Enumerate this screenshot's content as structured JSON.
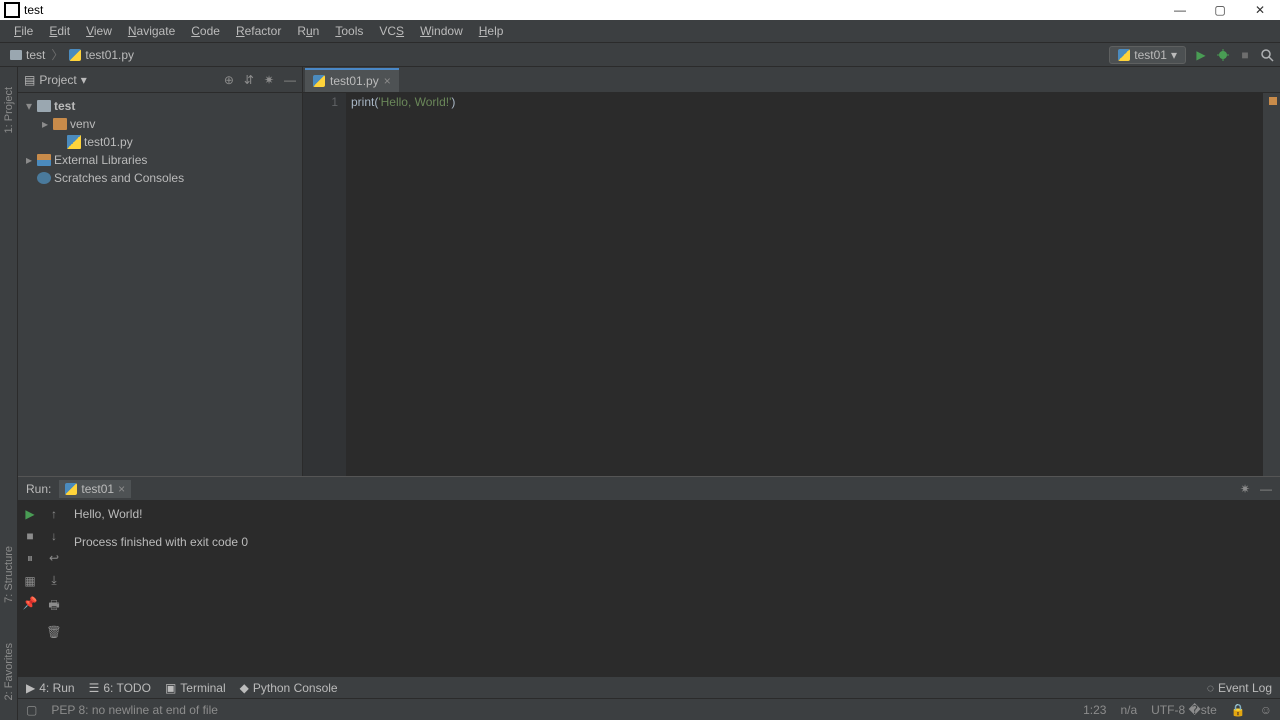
{
  "window": {
    "title": "test"
  },
  "menus": [
    "File",
    "Edit",
    "View",
    "Navigate",
    "Code",
    "Refactor",
    "Run",
    "Tools",
    "VCS",
    "Window",
    "Help"
  ],
  "breadcrumbs": {
    "project": "test",
    "file": "test01.py"
  },
  "run_config": {
    "selected": "test01"
  },
  "project_panel": {
    "title": "Project",
    "tree": {
      "root": "test",
      "venv": "venv",
      "file1": "test01.py",
      "external": "External Libraries",
      "scratches": "Scratches and Consoles"
    }
  },
  "editor": {
    "tab_label": "test01.py",
    "line_numbers": [
      "1"
    ],
    "code": {
      "fn": "print",
      "paren_open": "(",
      "string": "'Hello, World!'",
      "paren_close": ")"
    }
  },
  "run_tool": {
    "label": "Run:",
    "tab": "test01",
    "output_line1": "Hello, World!",
    "output_line2": "",
    "output_line3": "Process finished with exit code 0"
  },
  "bottom_tabs": {
    "run": "4: Run",
    "todo": "6: TODO",
    "terminal": "Terminal",
    "pyconsole": "Python Console",
    "eventlog": "Event Log"
  },
  "status": {
    "msg": "PEP 8: no newline at end of file",
    "pos": "1:23",
    "insert": "n/a",
    "encoding": "UTF-8"
  }
}
